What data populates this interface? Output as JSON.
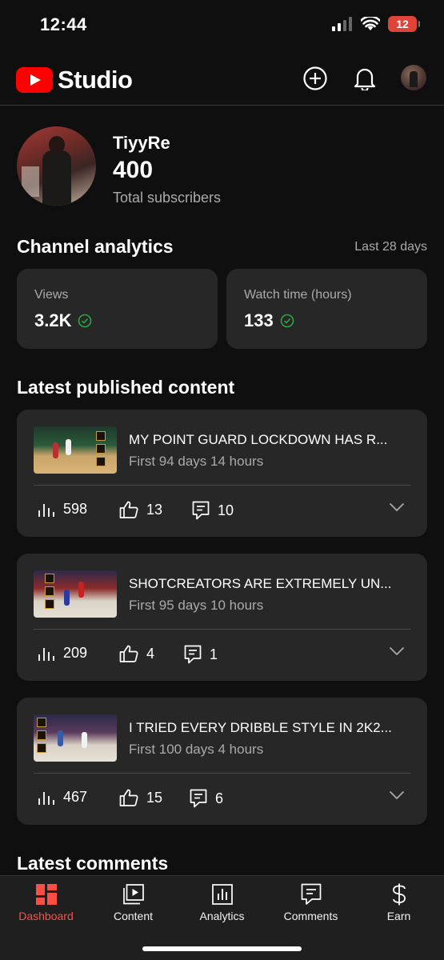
{
  "status_bar": {
    "time": "12:44",
    "battery": "12"
  },
  "header": {
    "logo_text": "Studio",
    "icons": [
      "create-icon",
      "notifications-icon",
      "account-avatar"
    ]
  },
  "channel": {
    "name": "TiyyRe",
    "subscribers": "400",
    "subscribers_label": "Total subscribers"
  },
  "analytics": {
    "title": "Channel analytics",
    "period": "Last 28 days",
    "cards": [
      {
        "label": "Views",
        "value": "3.2K"
      },
      {
        "label": "Watch time (hours)",
        "value": "133"
      }
    ]
  },
  "latest_content": {
    "title": "Latest published content",
    "videos": [
      {
        "title": "MY POINT GUARD LOCKDOWN HAS R...",
        "subtitle": "First 94 days 14 hours",
        "views": "598",
        "likes": "13",
        "comments": "10"
      },
      {
        "title": "SHOTCREATORS ARE EXTREMELY UN...",
        "subtitle": "First 95 days 10 hours",
        "views": "209",
        "likes": "4",
        "comments": "1"
      },
      {
        "title": "I TRIED EVERY DRIBBLE STYLE IN 2K2...",
        "subtitle": "First 100 days 4 hours",
        "views": "467",
        "likes": "15",
        "comments": "6"
      }
    ]
  },
  "latest_comments": {
    "title": "Latest comments"
  },
  "bottom_nav": {
    "items": [
      {
        "label": "Dashboard",
        "icon": "dashboard-icon",
        "active": true
      },
      {
        "label": "Content",
        "icon": "content-icon"
      },
      {
        "label": "Analytics",
        "icon": "analytics-icon"
      },
      {
        "label": "Comments",
        "icon": "comments-icon"
      },
      {
        "label": "Earn",
        "icon": "earn-icon"
      }
    ]
  },
  "colors": {
    "accent": "#ff0000",
    "active_nav": "#ff4e45",
    "check": "#2ba640",
    "card_bg": "#272727",
    "page_bg": "#0f0f0f"
  }
}
